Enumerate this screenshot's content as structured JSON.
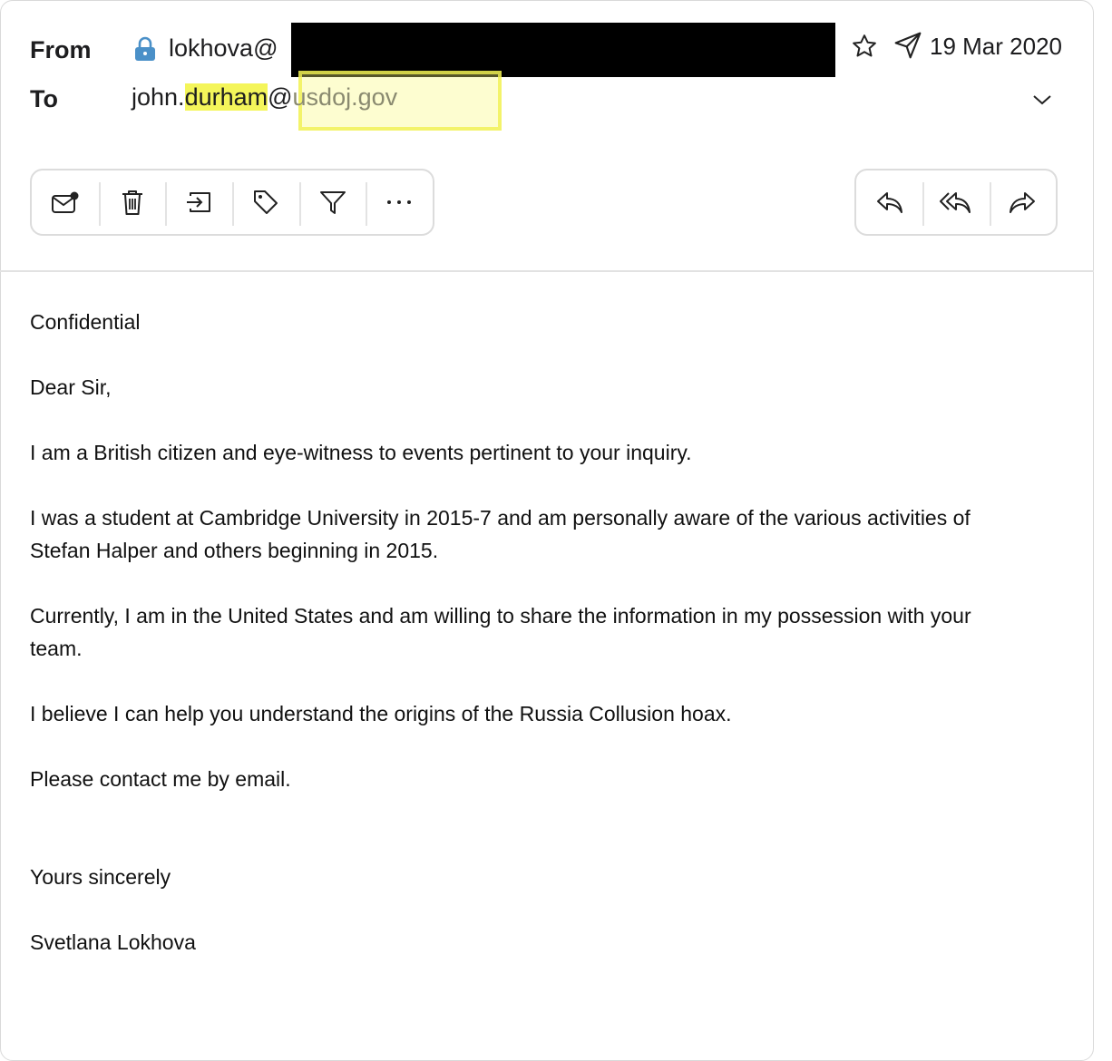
{
  "header": {
    "from_label": "From",
    "to_label": "To",
    "from_address_visible": "lokhova@",
    "to_address_user": "john.",
    "to_address_highlight": "durham",
    "to_address_at": "@",
    "to_address_domain": "usdoj.gov",
    "date": "19 Mar 2020"
  },
  "toolbar_left": [
    {
      "icon": "mark-unread-icon"
    },
    {
      "icon": "trash-icon"
    },
    {
      "icon": "move-icon"
    },
    {
      "icon": "tag-icon"
    },
    {
      "icon": "filter-icon"
    },
    {
      "icon": "more-icon"
    }
  ],
  "toolbar_right": [
    {
      "icon": "reply-icon"
    },
    {
      "icon": "reply-all-icon"
    },
    {
      "icon": "forward-icon"
    }
  ],
  "email_body": {
    "p1": "Confidential",
    "p2": "Dear Sir,",
    "p3": "I am a British citizen and eye-witness to events pertinent to your inquiry.",
    "p4_line1": "I was a student at Cambridge University in 2015-7 and am personally aware of the various activities of",
    "p4_line2": "Stefan Halper and others beginning in 2015.",
    "p5_line1": "Currently, I am in the United States and am willing to share the information in my possession with your",
    "p5_line2": "team.",
    "p6": "I believe I can help you understand the origins of the Russia Collusion hoax.",
    "p7": "Please contact me by email.",
    "closing": "Yours sincerely",
    "signature": "Svetlana Lokhova"
  },
  "colors": {
    "highlight": "#f4f55a",
    "lock_blue": "#4a90c8",
    "redaction": "#000000"
  }
}
